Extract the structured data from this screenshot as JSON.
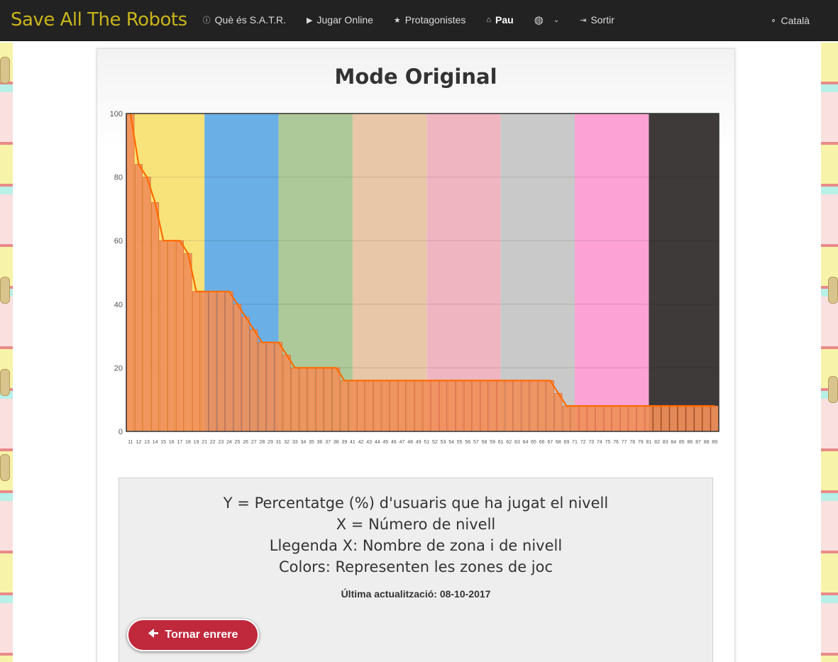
{
  "navbar": {
    "brand": "Save All The Robots",
    "items": [
      {
        "icon": "info-circle-icon",
        "glyph": "ⓘ",
        "label": "Què és S.A.T.R."
      },
      {
        "icon": "play-icon",
        "glyph": "▶",
        "label": "Jugar Online"
      },
      {
        "icon": "star-icon",
        "glyph": "★",
        "label": "Protagonistes"
      },
      {
        "icon": "home-icon",
        "glyph": "⌂",
        "label": "Pau"
      },
      {
        "icon": "globe-icon",
        "glyph": "◍",
        "label": ""
      },
      {
        "icon": "sign-out-icon",
        "glyph": "⇥",
        "label": "Sortir"
      }
    ],
    "language": {
      "icon": "comment-icon",
      "label": "Català"
    }
  },
  "page": {
    "title": "Mode Original"
  },
  "chart_data": {
    "type": "bar",
    "title": "",
    "xlabel": "",
    "ylabel": "",
    "ylim": [
      0,
      100
    ],
    "yticks": [
      0,
      20,
      40,
      60,
      80,
      100
    ],
    "grid": true,
    "categories": [
      "11",
      "12",
      "13",
      "14",
      "15",
      "16",
      "17",
      "18",
      "19",
      "21",
      "22",
      "23",
      "24",
      "25",
      "26",
      "27",
      "28",
      "29",
      "31",
      "32",
      "33",
      "34",
      "35",
      "36",
      "37",
      "38",
      "39",
      "41",
      "42",
      "43",
      "44",
      "45",
      "46",
      "47",
      "48",
      "49",
      "51",
      "52",
      "53",
      "54",
      "55",
      "56",
      "57",
      "58",
      "59",
      "61",
      "62",
      "63",
      "64",
      "65",
      "66",
      "67",
      "68",
      "69",
      "71",
      "72",
      "73",
      "74",
      "75",
      "76",
      "77",
      "78",
      "79",
      "81",
      "82",
      "83",
      "84",
      "85",
      "86",
      "87",
      "88",
      "89"
    ],
    "values": [
      100,
      84,
      80,
      72,
      60,
      60,
      60,
      56,
      44,
      44,
      44,
      44,
      44,
      40,
      36,
      32,
      28,
      28,
      28,
      24,
      20,
      20,
      20,
      20,
      20,
      20,
      16,
      16,
      16,
      16,
      16,
      16,
      16,
      16,
      16,
      16,
      16,
      16,
      16,
      16,
      16,
      16,
      16,
      16,
      16,
      16,
      16,
      16,
      16,
      16,
      16,
      16,
      12,
      8,
      8,
      8,
      8,
      8,
      8,
      8,
      8,
      8,
      8,
      8,
      8,
      8,
      8,
      8,
      8,
      8,
      8,
      8
    ],
    "bar_color": "#f0905a",
    "line_color": "#ff6a00",
    "zones": [
      {
        "color": "#f7e37a",
        "levels": "11-19"
      },
      {
        "color": "#6aafe6",
        "levels": "21-29"
      },
      {
        "color": "#adc999",
        "levels": "31-39"
      },
      {
        "color": "#e7c7a7",
        "levels": "41-49"
      },
      {
        "color": "#efb5c1",
        "levels": "51-59"
      },
      {
        "color": "#c9c9c9",
        "levels": "61-69"
      },
      {
        "color": "#fca2d4",
        "levels": "71-79"
      },
      {
        "color": "#3f3a3a",
        "levels": "81-89"
      }
    ]
  },
  "legend_box": {
    "lines": [
      "Y = Percentatge (%) d'usuaris que ha jugat el nivell",
      "X = Número de nivell",
      "Llegenda X: Nombre de zona i de nivell",
      "Colors: Representen les zones de joc"
    ],
    "updated": "Última actualització: 08-10-2017",
    "back_button": "Tornar enrere"
  }
}
